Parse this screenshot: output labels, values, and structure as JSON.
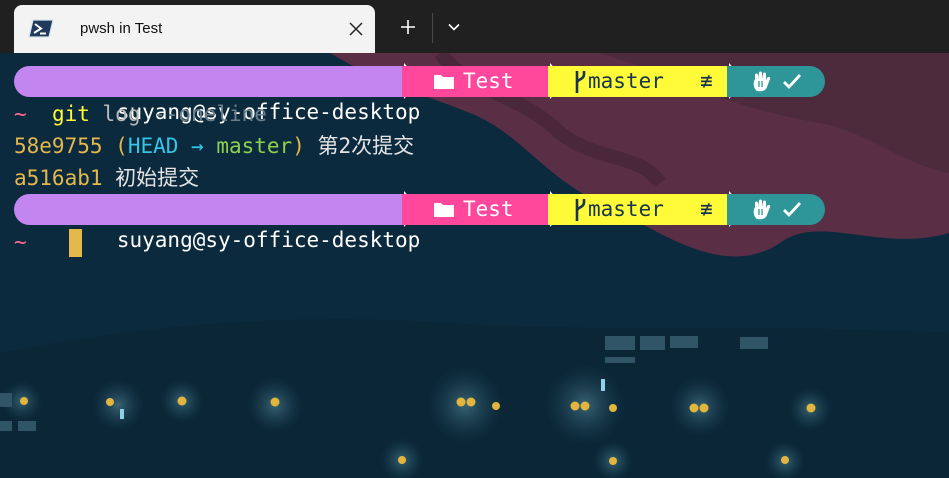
{
  "tab": {
    "title": "pwsh in Test",
    "icon": "powershell-icon"
  },
  "toolbar": {
    "new_tab_label": "+",
    "dropdown_icon": "chevron-down-icon"
  },
  "prompt": {
    "user_host": "suyang@sy-office-desktop",
    "folder_icon": "folder-icon",
    "path": "Test",
    "branch_icon": "git-branch-icon",
    "branch": "master",
    "branch_status": "≢",
    "status_icons": [
      "hand-icon",
      "check-icon"
    ],
    "home": "~"
  },
  "lines": {
    "command_name": "git",
    "command_rest": " log ",
    "command_flag": "--oneline",
    "commit1_hash": "58e9755",
    "commit1_ref_open": " (",
    "commit1_head": "HEAD",
    "commit1_arrow": " → ",
    "commit1_branch": "master",
    "commit1_ref_close": ")",
    "commit1_msg": " 第2次提交",
    "commit2_hash": "a516ab1",
    "commit2_msg": " 初始提交"
  },
  "colors": {
    "user_segment": "#c386f1",
    "path_segment": "#ff479c",
    "git_segment": "#fffb38",
    "status_segment": "#2e9599",
    "hash": "#e4b84b",
    "head": "#33c6e8",
    "branch": "#8ed14e",
    "tilde": "#ff6b8f",
    "cursor": "#e4b84b"
  }
}
